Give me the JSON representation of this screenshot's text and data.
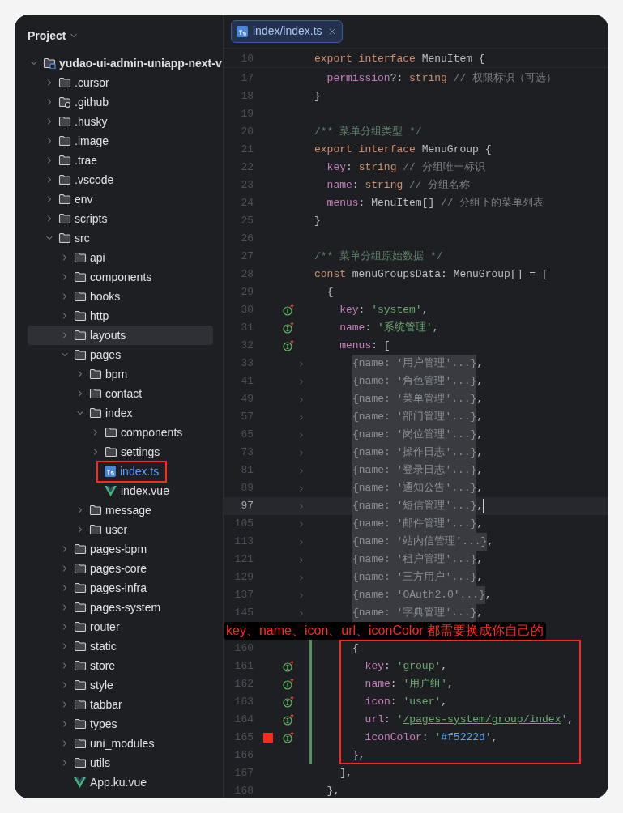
{
  "sidebar": {
    "title": "Project",
    "tree": [
      {
        "label": "yudao-ui-admin-uniapp-next-v",
        "kind": "root",
        "expanded": true,
        "selected": false,
        "boxed": false,
        "children": [
          {
            "label": ".cursor",
            "kind": "folder",
            "expanded": false,
            "selected": false,
            "boxed": false
          },
          {
            "label": ".github",
            "kind": "github-folder",
            "expanded": false,
            "selected": false,
            "boxed": false
          },
          {
            "label": ".husky",
            "kind": "folder",
            "expanded": false,
            "selected": false,
            "boxed": false
          },
          {
            "label": ".image",
            "kind": "folder",
            "expanded": false,
            "selected": false,
            "boxed": false
          },
          {
            "label": ".trae",
            "kind": "folder",
            "expanded": false,
            "selected": false,
            "boxed": false
          },
          {
            "label": ".vscode",
            "kind": "folder",
            "expanded": false,
            "selected": false,
            "boxed": false
          },
          {
            "label": "env",
            "kind": "folder",
            "expanded": false,
            "selected": false,
            "boxed": false
          },
          {
            "label": "scripts",
            "kind": "folder",
            "expanded": false,
            "selected": false,
            "boxed": false
          },
          {
            "label": "src",
            "kind": "folder",
            "expanded": true,
            "selected": false,
            "boxed": false,
            "children": [
              {
                "label": "api",
                "kind": "folder",
                "expanded": false,
                "selected": false,
                "boxed": false
              },
              {
                "label": "components",
                "kind": "folder",
                "expanded": false,
                "selected": false,
                "boxed": false
              },
              {
                "label": "hooks",
                "kind": "folder",
                "expanded": false,
                "selected": false,
                "boxed": false
              },
              {
                "label": "http",
                "kind": "folder",
                "expanded": false,
                "selected": false,
                "boxed": false
              },
              {
                "label": "layouts",
                "kind": "folder",
                "expanded": false,
                "selected": true,
                "boxed": false
              },
              {
                "label": "pages",
                "kind": "folder",
                "expanded": true,
                "selected": false,
                "boxed": false,
                "children": [
                  {
                    "label": "bpm",
                    "kind": "folder",
                    "expanded": false,
                    "selected": false,
                    "boxed": false
                  },
                  {
                    "label": "contact",
                    "kind": "folder",
                    "expanded": false,
                    "selected": false,
                    "boxed": false
                  },
                  {
                    "label": "index",
                    "kind": "folder",
                    "expanded": true,
                    "selected": false,
                    "boxed": false,
                    "children": [
                      {
                        "label": "components",
                        "kind": "folder",
                        "expanded": false,
                        "selected": false,
                        "boxed": false
                      },
                      {
                        "label": "settings",
                        "kind": "folder",
                        "expanded": false,
                        "selected": false,
                        "boxed": false
                      },
                      {
                        "label": "index.ts",
                        "kind": "ts",
                        "open": true,
                        "selected": false,
                        "boxed": true
                      },
                      {
                        "label": "index.vue",
                        "kind": "vue",
                        "open": false,
                        "selected": false,
                        "boxed": false
                      }
                    ]
                  },
                  {
                    "label": "message",
                    "kind": "folder",
                    "expanded": false,
                    "selected": false,
                    "boxed": false
                  },
                  {
                    "label": "user",
                    "kind": "folder",
                    "expanded": false,
                    "selected": false,
                    "boxed": false
                  }
                ]
              },
              {
                "label": "pages-bpm",
                "kind": "folder",
                "expanded": false,
                "selected": false,
                "boxed": false
              },
              {
                "label": "pages-core",
                "kind": "folder",
                "expanded": false,
                "selected": false,
                "boxed": false
              },
              {
                "label": "pages-infra",
                "kind": "folder",
                "expanded": false,
                "selected": false,
                "boxed": false
              },
              {
                "label": "pages-system",
                "kind": "folder",
                "expanded": false,
                "selected": false,
                "boxed": false
              },
              {
                "label": "router",
                "kind": "folder",
                "expanded": false,
                "selected": false,
                "boxed": false
              },
              {
                "label": "static",
                "kind": "folder",
                "expanded": false,
                "selected": false,
                "boxed": false
              },
              {
                "label": "store",
                "kind": "folder",
                "expanded": false,
                "selected": false,
                "boxed": false
              },
              {
                "label": "style",
                "kind": "folder",
                "expanded": false,
                "selected": false,
                "boxed": false
              },
              {
                "label": "tabbar",
                "kind": "folder",
                "expanded": false,
                "selected": false,
                "boxed": false
              },
              {
                "label": "types",
                "kind": "folder",
                "expanded": false,
                "selected": false,
                "boxed": false
              },
              {
                "label": "uni_modules",
                "kind": "folder",
                "expanded": false,
                "selected": false,
                "boxed": false
              },
              {
                "label": "utils",
                "kind": "folder",
                "expanded": false,
                "selected": false,
                "boxed": false
              },
              {
                "label": "App.ku.vue",
                "kind": "vue",
                "open": false,
                "selected": false,
                "boxed": false
              }
            ]
          }
        ]
      }
    ]
  },
  "editor": {
    "tabs": [
      {
        "label": "index/index.ts",
        "kind": "ts",
        "selected": true
      }
    ],
    "sticky_line": {
      "n": "10",
      "tokens": [
        {
          "kind": "kw",
          "text": "export interface "
        },
        {
          "kind": "plain",
          "text": "MenuItem {"
        }
      ]
    },
    "lines": [
      {
        "kind": "code",
        "n": "17",
        "tokens": [
          {
            "kind": "prop",
            "text": "  permission"
          },
          {
            "kind": "plain",
            "text": "?: "
          },
          {
            "kind": "kw",
            "text": "string"
          },
          {
            "kind": "cmt",
            "text": " // 权限标识（可选）"
          }
        ],
        "implemented": false,
        "folded": false,
        "changed": false,
        "current": false,
        "breakpoint": false
      },
      {
        "kind": "code",
        "n": "18",
        "tokens": [
          {
            "kind": "plain",
            "text": "}"
          }
        ],
        "implemented": false,
        "folded": false,
        "changed": false,
        "current": false,
        "breakpoint": false
      },
      {
        "kind": "code",
        "n": "19",
        "implemented": false,
        "folded": false,
        "changed": false,
        "current": false,
        "breakpoint": false
      },
      {
        "kind": "code",
        "n": "20",
        "tokens": [
          {
            "kind": "doc",
            "text": "/** 菜单分组类型 */"
          }
        ],
        "implemented": false,
        "folded": false,
        "changed": false,
        "current": false,
        "breakpoint": false
      },
      {
        "kind": "code",
        "n": "21",
        "tokens": [
          {
            "kind": "kw",
            "text": "export interface "
          },
          {
            "kind": "plain",
            "text": "MenuGroup {"
          }
        ],
        "implemented": false,
        "folded": false,
        "changed": false,
        "current": false,
        "breakpoint": false
      },
      {
        "kind": "code",
        "n": "22",
        "tokens": [
          {
            "kind": "prop",
            "text": "  key"
          },
          {
            "kind": "plain",
            "text": ": "
          },
          {
            "kind": "kw",
            "text": "string"
          },
          {
            "kind": "cmt",
            "text": " // 分组唯一标识"
          }
        ],
        "implemented": false,
        "folded": false,
        "changed": false,
        "current": false,
        "breakpoint": false
      },
      {
        "kind": "code",
        "n": "23",
        "tokens": [
          {
            "kind": "prop",
            "text": "  name"
          },
          {
            "kind": "plain",
            "text": ": "
          },
          {
            "kind": "kw",
            "text": "string"
          },
          {
            "kind": "cmt",
            "text": " // 分组名称"
          }
        ],
        "implemented": false,
        "folded": false,
        "changed": false,
        "current": false,
        "breakpoint": false
      },
      {
        "kind": "code",
        "n": "24",
        "tokens": [
          {
            "kind": "prop",
            "text": "  menus"
          },
          {
            "kind": "plain",
            "text": ": MenuItem[]"
          },
          {
            "kind": "cmt",
            "text": " // 分组下的菜单列表"
          }
        ],
        "implemented": false,
        "folded": false,
        "changed": false,
        "current": false,
        "breakpoint": false
      },
      {
        "kind": "code",
        "n": "25",
        "tokens": [
          {
            "kind": "plain",
            "text": "}"
          }
        ],
        "implemented": false,
        "folded": false,
        "changed": false,
        "current": false,
        "breakpoint": false
      },
      {
        "kind": "code",
        "n": "26",
        "implemented": false,
        "folded": false,
        "changed": false,
        "current": false,
        "breakpoint": false
      },
      {
        "kind": "code",
        "n": "27",
        "tokens": [
          {
            "kind": "doc",
            "text": "/** 菜单分组原始数据 */"
          }
        ],
        "implemented": false,
        "folded": false,
        "changed": false,
        "current": false,
        "breakpoint": false
      },
      {
        "kind": "code",
        "n": "28",
        "tokens": [
          {
            "kind": "kw",
            "text": "const "
          },
          {
            "kind": "plain",
            "text": "menuGroupsData: MenuGroup[] = ["
          }
        ],
        "implemented": false,
        "folded": false,
        "changed": false,
        "current": false,
        "breakpoint": false
      },
      {
        "kind": "code",
        "n": "29",
        "tokens": [
          {
            "kind": "plain",
            "text": "  {"
          }
        ],
        "implemented": false,
        "folded": false,
        "changed": false,
        "current": false,
        "breakpoint": false
      },
      {
        "kind": "code",
        "n": "30",
        "tokens": [
          {
            "kind": "prop",
            "text": "    key"
          },
          {
            "kind": "plain",
            "text": ": "
          },
          {
            "kind": "str",
            "text": "'system'"
          },
          {
            "kind": "plain",
            "text": ","
          }
        ],
        "implemented": true,
        "folded": false,
        "changed": false,
        "current": false,
        "breakpoint": false
      },
      {
        "kind": "code",
        "n": "31",
        "tokens": [
          {
            "kind": "prop",
            "text": "    name"
          },
          {
            "kind": "plain",
            "text": ": "
          },
          {
            "kind": "str",
            "text": "'系统管理'"
          },
          {
            "kind": "plain",
            "text": ","
          }
        ],
        "implemented": true,
        "folded": false,
        "changed": false,
        "current": false,
        "breakpoint": false
      },
      {
        "kind": "code",
        "n": "32",
        "tokens": [
          {
            "kind": "prop",
            "text": "    menus"
          },
          {
            "kind": "plain",
            "text": ": ["
          }
        ],
        "implemented": true,
        "folded": false,
        "changed": false,
        "current": false,
        "breakpoint": false
      },
      {
        "kind": "code",
        "n": "33",
        "tokens": [
          {
            "kind": "fold",
            "text": "{name: '用户管理'...}"
          },
          {
            "kind": "plain",
            "text": ","
          }
        ],
        "implemented": false,
        "folded": true,
        "changed": false,
        "current": false,
        "breakpoint": false
      },
      {
        "kind": "code",
        "n": "41",
        "tokens": [
          {
            "kind": "fold",
            "text": "{name: '角色管理'...}"
          },
          {
            "kind": "plain",
            "text": ","
          }
        ],
        "implemented": false,
        "folded": true,
        "changed": false,
        "current": false,
        "breakpoint": false
      },
      {
        "kind": "code",
        "n": "49",
        "tokens": [
          {
            "kind": "fold",
            "text": "{name: '菜单管理'...}"
          },
          {
            "kind": "plain",
            "text": ","
          }
        ],
        "implemented": false,
        "folded": true,
        "changed": false,
        "current": false,
        "breakpoint": false
      },
      {
        "kind": "code",
        "n": "57",
        "tokens": [
          {
            "kind": "fold",
            "text": "{name: '部门管理'...}"
          },
          {
            "kind": "plain",
            "text": ","
          }
        ],
        "implemented": false,
        "folded": true,
        "changed": false,
        "current": false,
        "breakpoint": false
      },
      {
        "kind": "code",
        "n": "65",
        "tokens": [
          {
            "kind": "fold",
            "text": "{name: '岗位管理'...}"
          },
          {
            "kind": "plain",
            "text": ","
          }
        ],
        "implemented": false,
        "folded": true,
        "changed": false,
        "current": false,
        "breakpoint": false
      },
      {
        "kind": "code",
        "n": "73",
        "tokens": [
          {
            "kind": "fold",
            "text": "{name: '操作日志'...}"
          },
          {
            "kind": "plain",
            "text": ","
          }
        ],
        "implemented": false,
        "folded": true,
        "changed": false,
        "current": false,
        "breakpoint": false
      },
      {
        "kind": "code",
        "n": "81",
        "tokens": [
          {
            "kind": "fold",
            "text": "{name: '登录日志'...}"
          },
          {
            "kind": "plain",
            "text": ","
          }
        ],
        "implemented": false,
        "folded": true,
        "changed": false,
        "current": false,
        "breakpoint": false
      },
      {
        "kind": "code",
        "n": "89",
        "tokens": [
          {
            "kind": "fold",
            "text": "{name: '通知公告'...}"
          },
          {
            "kind": "plain",
            "text": ","
          }
        ],
        "implemented": false,
        "folded": true,
        "changed": false,
        "current": false,
        "breakpoint": false
      },
      {
        "kind": "code",
        "n": "97",
        "tokens": [
          {
            "kind": "fold",
            "text": "{name: '短信管理'...}"
          },
          {
            "kind": "plain",
            "text": ","
          }
        ],
        "implemented": false,
        "folded": true,
        "changed": false,
        "current": true,
        "breakpoint": false
      },
      {
        "kind": "code",
        "n": "105",
        "tokens": [
          {
            "kind": "fold",
            "text": "{name: '邮件管理'...}"
          },
          {
            "kind": "plain",
            "text": ","
          }
        ],
        "implemented": false,
        "folded": true,
        "changed": false,
        "current": false,
        "breakpoint": false
      },
      {
        "kind": "code",
        "n": "113",
        "tokens": [
          {
            "kind": "fold",
            "text": "{name: '站内信管理'...}"
          },
          {
            "kind": "plain",
            "text": ","
          }
        ],
        "implemented": false,
        "folded": true,
        "changed": false,
        "current": false,
        "breakpoint": false
      },
      {
        "kind": "code",
        "n": "121",
        "tokens": [
          {
            "kind": "fold",
            "text": "{name: '租户管理'...}"
          },
          {
            "kind": "plain",
            "text": ","
          }
        ],
        "implemented": false,
        "folded": true,
        "changed": false,
        "current": false,
        "breakpoint": false
      },
      {
        "kind": "code",
        "n": "129",
        "tokens": [
          {
            "kind": "fold",
            "text": "{name: '三方用户'...}"
          },
          {
            "kind": "plain",
            "text": ","
          }
        ],
        "implemented": false,
        "folded": true,
        "changed": false,
        "current": false,
        "breakpoint": false
      },
      {
        "kind": "code",
        "n": "137",
        "tokens": [
          {
            "kind": "fold",
            "text": "{name: 'OAuth2.0'...}"
          },
          {
            "kind": "plain",
            "text": ","
          }
        ],
        "implemented": false,
        "folded": true,
        "changed": false,
        "current": false,
        "breakpoint": false
      },
      {
        "kind": "code",
        "n": "145",
        "tokens": [
          {
            "kind": "fold",
            "text": "{name: '字典管理'...}"
          },
          {
            "kind": "plain",
            "text": ","
          }
        ],
        "implemented": false,
        "folded": true,
        "changed": false,
        "current": false,
        "breakpoint": false
      },
      {
        "kind": "note",
        "text": "key、name、icon、url、iconColor 都需要换成你自己的"
      },
      {
        "kind": "boxed_group",
        "lines": [
          {
            "kind": "code",
            "n": "160",
            "tokens": [
              {
                "kind": "plain",
                "text": "{"
              }
            ],
            "implemented": false,
            "folded": false,
            "changed": true,
            "current": false,
            "breakpoint": false
          },
          {
            "kind": "code",
            "n": "161",
            "tokens": [
              {
                "kind": "prop",
                "text": "  key"
              },
              {
                "kind": "plain",
                "text": ": "
              },
              {
                "kind": "str",
                "text": "'group'"
              },
              {
                "kind": "plain",
                "text": ","
              }
            ],
            "implemented": true,
            "folded": false,
            "changed": true,
            "current": false,
            "breakpoint": false
          },
          {
            "kind": "code",
            "n": "162",
            "tokens": [
              {
                "kind": "prop",
                "text": "  name"
              },
              {
                "kind": "plain",
                "text": ": "
              },
              {
                "kind": "str",
                "text": "'用户组'"
              },
              {
                "kind": "plain",
                "text": ","
              }
            ],
            "implemented": true,
            "folded": false,
            "changed": true,
            "current": false,
            "breakpoint": false
          },
          {
            "kind": "code",
            "n": "163",
            "tokens": [
              {
                "kind": "prop",
                "text": "  icon"
              },
              {
                "kind": "plain",
                "text": ": "
              },
              {
                "kind": "str",
                "text": "'user'"
              },
              {
                "kind": "plain",
                "text": ","
              }
            ],
            "implemented": true,
            "folded": false,
            "changed": true,
            "current": false,
            "breakpoint": false
          },
          {
            "kind": "code",
            "n": "164",
            "tokens": [
              {
                "kind": "prop",
                "text": "  url"
              },
              {
                "kind": "plain",
                "text": ": "
              },
              {
                "kind": "str",
                "text": "'"
              },
              {
                "kind": "link",
                "text": "/pages-system/group/index"
              },
              {
                "kind": "str",
                "text": "'"
              },
              {
                "kind": "plain",
                "text": ","
              }
            ],
            "implemented": true,
            "folded": false,
            "changed": true,
            "current": false,
            "breakpoint": false
          },
          {
            "kind": "code",
            "n": "165",
            "tokens": [
              {
                "kind": "prop",
                "text": "  iconColor"
              },
              {
                "kind": "plain",
                "text": ": "
              },
              {
                "kind": "str",
                "text": "'"
              },
              {
                "kind": "hex",
                "text": "#f5222d"
              },
              {
                "kind": "str",
                "text": "'"
              },
              {
                "kind": "plain",
                "text": ","
              }
            ],
            "implemented": true,
            "folded": false,
            "changed": true,
            "current": false,
            "breakpoint": true
          },
          {
            "kind": "code",
            "n": "166",
            "tokens": [
              {
                "kind": "plain",
                "text": "},"
              }
            ],
            "implemented": false,
            "folded": false,
            "changed": true,
            "current": false,
            "breakpoint": false
          }
        ]
      },
      {
        "kind": "code",
        "n": "167",
        "tokens": [
          {
            "kind": "plain",
            "text": "    ],"
          }
        ],
        "implemented": false,
        "folded": false,
        "changed": false,
        "current": false,
        "breakpoint": false
      },
      {
        "kind": "code",
        "n": "168",
        "tokens": [
          {
            "kind": "plain",
            "text": "  },"
          }
        ],
        "implemented": false,
        "folded": false,
        "changed": false,
        "current": false,
        "breakpoint": false
      }
    ]
  }
}
